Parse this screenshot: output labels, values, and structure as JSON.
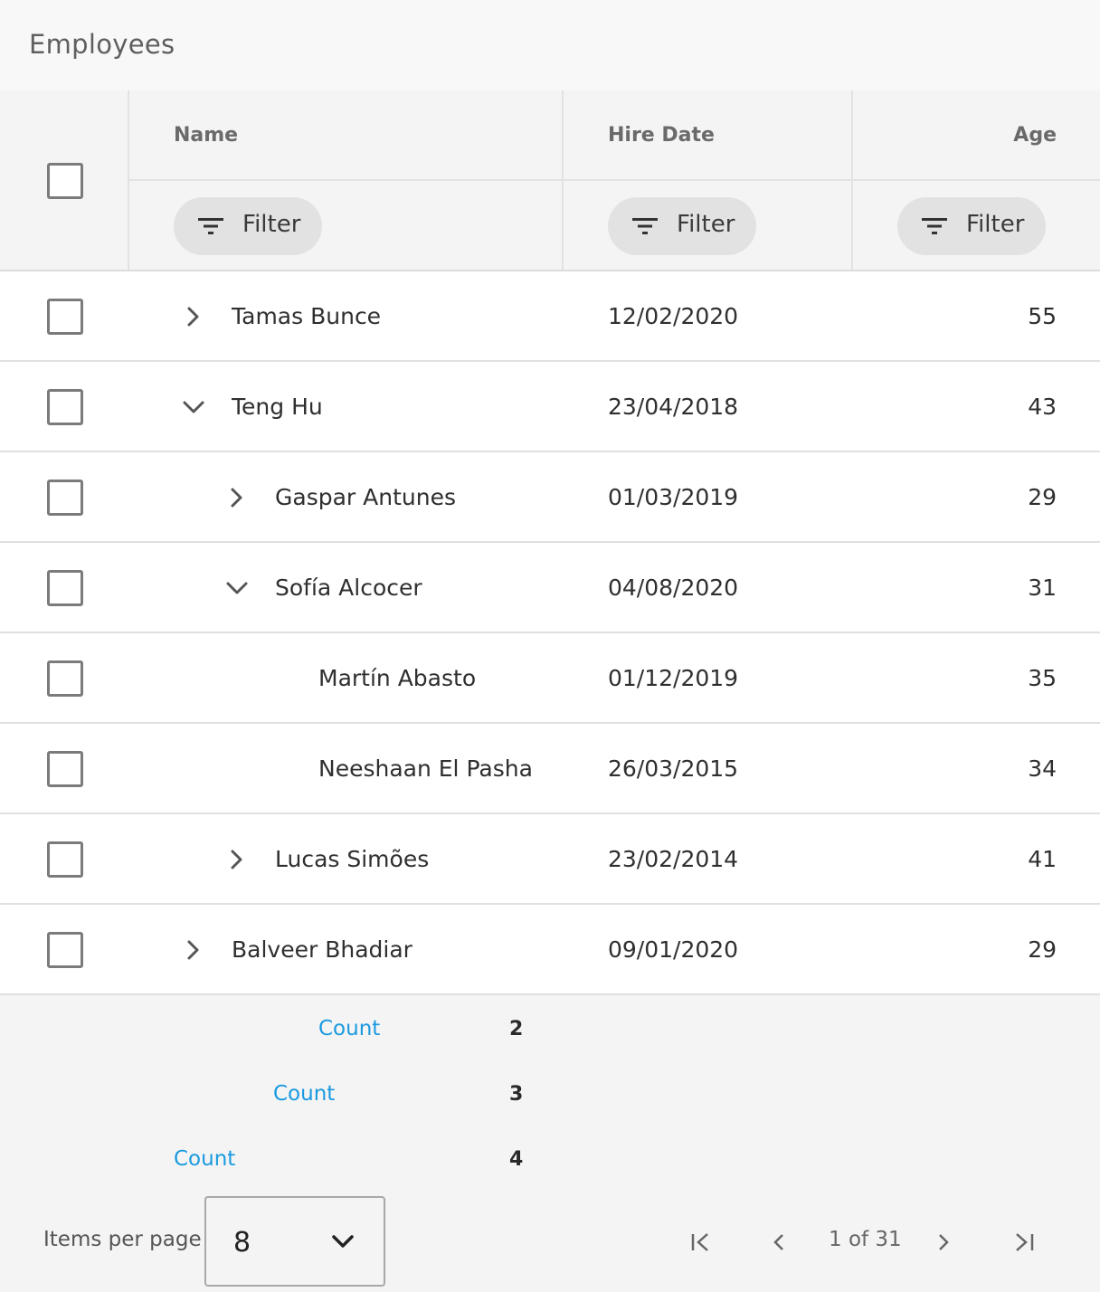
{
  "title": "Employees",
  "columns": {
    "name": "Name",
    "hire_date": "Hire Date",
    "age": "Age"
  },
  "filter_label": "Filter",
  "rows": [
    {
      "name": "Tamas Bunce",
      "hire_date": "12/02/2020",
      "age": "55",
      "level": 0,
      "toggle": "collapsed"
    },
    {
      "name": "Teng Hu",
      "hire_date": "23/04/2018",
      "age": "43",
      "level": 0,
      "toggle": "expanded"
    },
    {
      "name": "Gaspar Antunes",
      "hire_date": "01/03/2019",
      "age": "29",
      "level": 1,
      "toggle": "collapsed"
    },
    {
      "name": "Sofía Alcocer",
      "hire_date": "04/08/2020",
      "age": "31",
      "level": 1,
      "toggle": "expanded"
    },
    {
      "name": "Martín Abasto",
      "hire_date": "01/12/2019",
      "age": "35",
      "level": 2,
      "toggle": "none"
    },
    {
      "name": "Neeshaan El Pasha",
      "hire_date": "26/03/2015",
      "age": "34",
      "level": 2,
      "toggle": "none"
    },
    {
      "name": "Lucas Simões",
      "hire_date": "23/02/2014",
      "age": "41",
      "level": 1,
      "toggle": "collapsed"
    },
    {
      "name": "Balveer Bhadiar",
      "hire_date": "09/01/2020",
      "age": "29",
      "level": 0,
      "toggle": "collapsed"
    }
  ],
  "summaries": [
    {
      "label": "Count",
      "value": "2"
    },
    {
      "label": "Count",
      "value": "3"
    },
    {
      "label": "Count",
      "value": "4"
    }
  ],
  "paginator": {
    "items_per_page_label": "Items per page",
    "items_per_page_value": "8",
    "page_text": "1 of 31"
  },
  "colors": {
    "accent": "#1a9ae0",
    "header_bg": "#f4f4f4",
    "chip_bg": "#e2e2e2"
  }
}
